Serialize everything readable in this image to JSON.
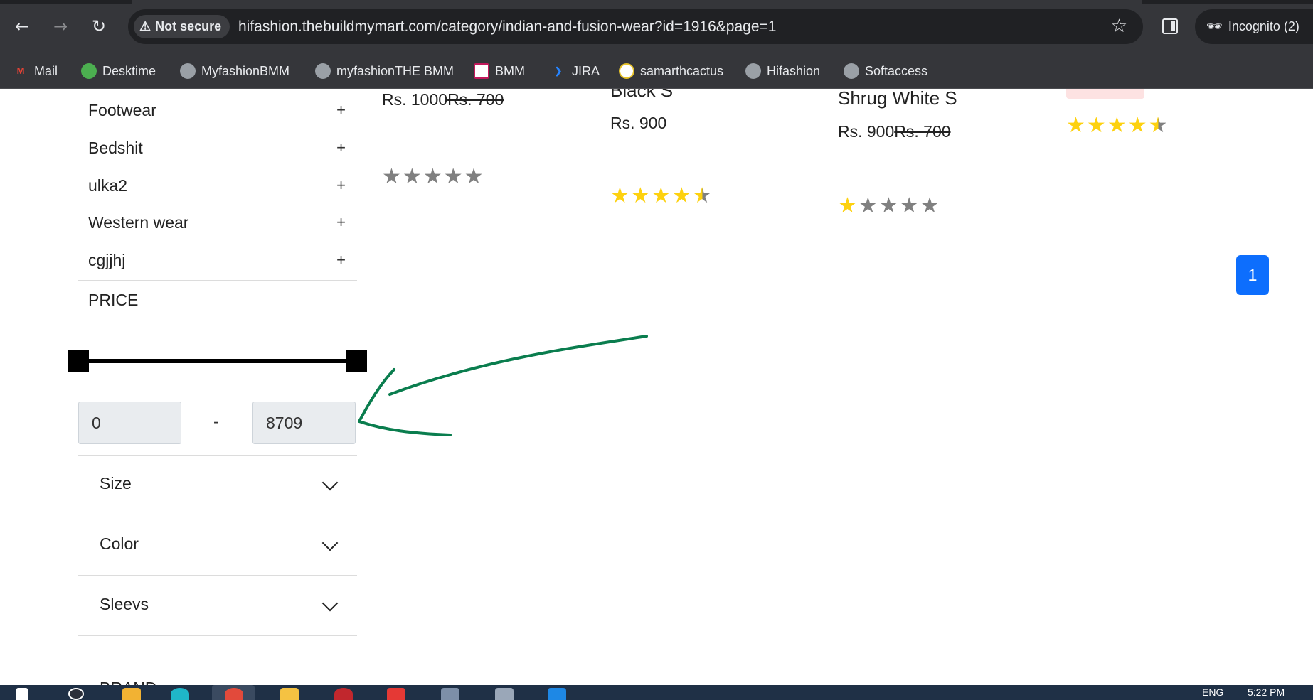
{
  "browser": {
    "security_label": "Not secure",
    "url": "hifashion.thebuildmymart.com/category/indian-and-fusion-wear?id=1916&page=1",
    "profile_label": "Incognito (2)"
  },
  "bookmarks": [
    {
      "label": "Mail",
      "icon": "gmail-icon",
      "color": "#ea4335"
    },
    {
      "label": "Desktime",
      "icon": "desktime-icon",
      "color": "#4caf50"
    },
    {
      "label": "MyfashionBMM",
      "icon": "globe-icon",
      "color": "#9aa0a6"
    },
    {
      "label": "myfashionTHE BMM",
      "icon": "globe-icon",
      "color": "#9aa0a6"
    },
    {
      "label": "BMM",
      "icon": "bmm-icon",
      "color": "#c2185b"
    },
    {
      "label": "JIRA",
      "icon": "jira-icon",
      "color": "#2684ff"
    },
    {
      "label": "samarthcactus",
      "icon": "cactus-icon",
      "color": "#e6c229"
    },
    {
      "label": "Hifashion",
      "icon": "globe-icon",
      "color": "#9aa0a6"
    },
    {
      "label": "Softaccess",
      "icon": "globe-icon",
      "color": "#9aa0a6"
    }
  ],
  "sidebar": {
    "categories": [
      {
        "label": "Footwear",
        "toggle": "+"
      },
      {
        "label": "Bedshit",
        "toggle": "+"
      },
      {
        "label": "ulka2",
        "toggle": "+"
      },
      {
        "label": "Western wear",
        "toggle": "+"
      },
      {
        "label": "cgjjhj",
        "toggle": "+"
      }
    ],
    "price_title": "PRICE",
    "price_min": "0",
    "price_separator": "-",
    "price_max": "8709",
    "filters": [
      {
        "label": "Size"
      },
      {
        "label": "Color"
      },
      {
        "label": "Sleevs"
      }
    ],
    "next_filter_partial": "BRAND"
  },
  "products": [
    {
      "title": "",
      "price": "Rs. 1000",
      "old_price": "Rs. 700",
      "rating": 0
    },
    {
      "title": "Black S",
      "price": "Rs. 900",
      "old_price": "",
      "rating": 4.5
    },
    {
      "title": "Shrug White S",
      "price": "Rs. 900",
      "old_price": "Rs. 700",
      "rating": 1
    },
    {
      "title": "",
      "price": "",
      "old_price": "",
      "rating": 4.5
    }
  ],
  "pagination": {
    "current_page": "1"
  },
  "taskbar": {
    "lang": "ENG",
    "time": "5:22 PM"
  },
  "colors": {
    "chrome_bg": "#35363a",
    "star_on": "#fdd10f",
    "star_off": "#808080",
    "accent": "#0d6efd",
    "annotation_arrow": "#0a7d4e"
  }
}
